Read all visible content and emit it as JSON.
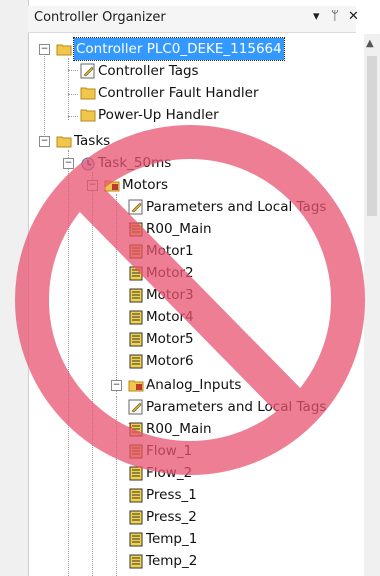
{
  "panel": {
    "title": "Controller Organizer",
    "dropdown_icon": "chevron-down-icon",
    "pin_icon": "pin-icon",
    "close_icon": "close-icon"
  },
  "tree": {
    "controller": "Controller PLC0_DEKE_115664",
    "controller_tags": "Controller Tags",
    "fault_handler": "Controller Fault Handler",
    "powerup_handler": "Power-Up Handler",
    "tasks": "Tasks",
    "task": "Task_50ms",
    "motors": {
      "label": "Motors",
      "params": "Parameters and Local Tags",
      "main": "R00_Main",
      "routines": [
        "Motor1",
        "Motor2",
        "Motor3",
        "Motor4",
        "Motor5",
        "Motor6"
      ]
    },
    "analog": {
      "label": "Analog_Inputs",
      "params": "Parameters and Local Tags",
      "main": "R00_Main",
      "routines": [
        "Flow_1",
        "Flow_2",
        "Press_1",
        "Press_2",
        "Temp_1",
        "Temp_2"
      ]
    }
  },
  "overlay": {
    "icon": "prohibited-sign-icon",
    "color": "#e8536f"
  }
}
